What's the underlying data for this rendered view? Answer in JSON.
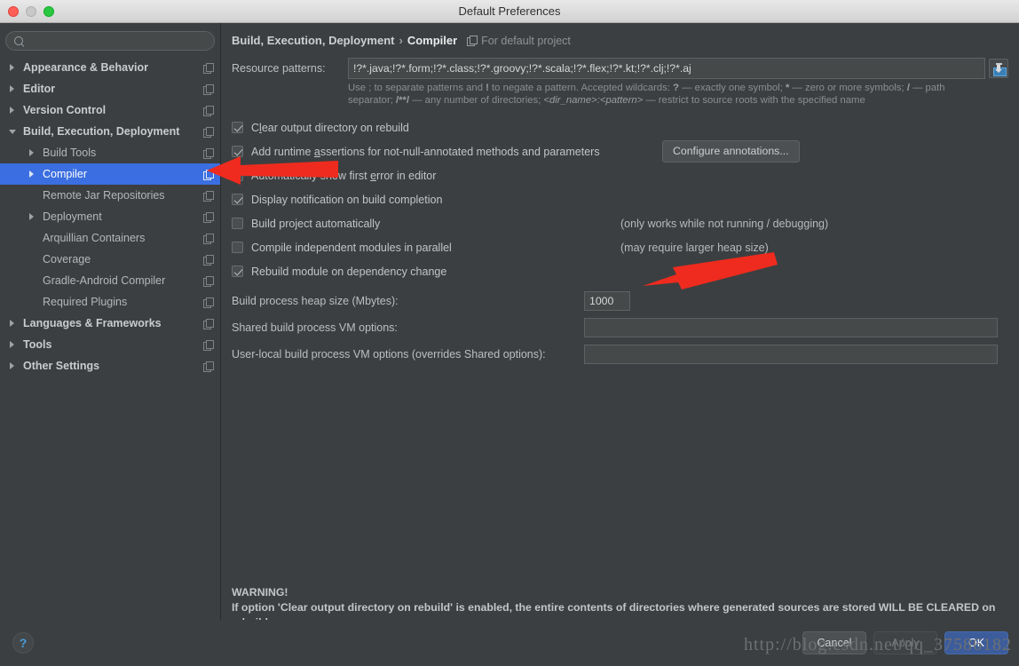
{
  "window": {
    "title": "Default Preferences"
  },
  "search": {
    "value": "",
    "placeholder": ""
  },
  "sidebar": {
    "items": [
      {
        "label": "Appearance & Behavior",
        "level": 0,
        "twisty": "right",
        "selected": false
      },
      {
        "label": "Editor",
        "level": 0,
        "twisty": "right",
        "selected": false
      },
      {
        "label": "Version Control",
        "level": 0,
        "twisty": "right",
        "selected": false
      },
      {
        "label": "Build, Execution, Deployment",
        "level": 0,
        "twisty": "down",
        "selected": false
      },
      {
        "label": "Build Tools",
        "level": 1,
        "twisty": "right",
        "selected": false
      },
      {
        "label": "Compiler",
        "level": 1,
        "twisty": "right",
        "selected": true
      },
      {
        "label": "Remote Jar Repositories",
        "level": 1,
        "twisty": "none",
        "selected": false
      },
      {
        "label": "Deployment",
        "level": 1,
        "twisty": "right",
        "selected": false
      },
      {
        "label": "Arquillian Containers",
        "level": 1,
        "twisty": "none",
        "selected": false
      },
      {
        "label": "Coverage",
        "level": 1,
        "twisty": "none",
        "selected": false
      },
      {
        "label": "Gradle-Android Compiler",
        "level": 1,
        "twisty": "none",
        "selected": false
      },
      {
        "label": "Required Plugins",
        "level": 1,
        "twisty": "none",
        "selected": false
      },
      {
        "label": "Languages & Frameworks",
        "level": 0,
        "twisty": "right",
        "selected": false
      },
      {
        "label": "Tools",
        "level": 0,
        "twisty": "right",
        "selected": false
      },
      {
        "label": "Other Settings",
        "level": 0,
        "twisty": "right",
        "selected": false
      }
    ]
  },
  "breadcrumb": {
    "parent": "Build, Execution, Deployment",
    "separator": "›",
    "current": "Compiler",
    "note": "For default project"
  },
  "main": {
    "pattern_label": "Resource patterns:",
    "pattern_value": "!?*.java;!?*.form;!?*.class;!?*.groovy;!?*.scala;!?*.flex;!?*.kt;!?*.clj;!?*.aj",
    "pattern_hint_line1_a": "Use ; to separate patterns and ",
    "pattern_hint_line1_b": "!",
    "pattern_hint_line1_c": " to negate a pattern. Accepted wildcards: ",
    "pattern_hint_line1_d": "?",
    "pattern_hint_line1_e": " — exactly one symbol; ",
    "pattern_hint_line1_f": "*",
    "pattern_hint_line1_g": " — zero or more symbols; ",
    "pattern_hint_line1_h": "/",
    "pattern_hint_line1_i": " — path separator; ",
    "pattern_hint_line1_j": "/**/",
    "pattern_hint_line1_k": " — any number of directories; ",
    "pattern_hint_line1_l": "<dir_name>:<pattern>",
    "pattern_hint_line1_m": " — restrict to source roots with the specified name",
    "checkboxes": [
      {
        "label_pre": "C",
        "label_mn": "l",
        "label_post": "ear output directory on rebuild",
        "checked": true,
        "note": "",
        "name": "clear-output-directory-on-rebuild"
      },
      {
        "label_pre": "Add runtime ",
        "label_mn": "a",
        "label_post": "ssertions for not-null-annotated methods and parameters",
        "checked": true,
        "note": "",
        "name": "add-runtime-assertions"
      },
      {
        "label_pre": "Automatically show first ",
        "label_mn": "e",
        "label_post": "rror in editor",
        "checked": true,
        "note": "",
        "name": "automatically-show-first-error"
      },
      {
        "label_pre": "Display notification on build completion",
        "label_mn": "",
        "label_post": "",
        "checked": true,
        "note": "",
        "name": "display-notification-on-build-completion"
      },
      {
        "label_pre": "Build project automatically",
        "label_mn": "",
        "label_post": "",
        "checked": false,
        "note": "(only works while not running / debugging)",
        "name": "build-project-automatically"
      },
      {
        "label_pre": "Compile independent modules in parallel",
        "label_mn": "",
        "label_post": "",
        "checked": false,
        "note": "(may require larger heap size)",
        "name": "compile-independent-modules-in-parallel"
      },
      {
        "label_pre": "Rebuild module on dependency change",
        "label_mn": "",
        "label_post": "",
        "checked": true,
        "note": "",
        "name": "rebuild-module-on-dependency-change"
      }
    ],
    "configure_annotations_label": "Configure annotations...",
    "heap_label": "Build process heap size (Mbytes):",
    "heap_value": "1000",
    "shared_vm_label": "Shared build process VM options:",
    "shared_vm_value": "",
    "userlocal_vm_label": "User-local build process VM options (overrides Shared options):",
    "userlocal_vm_value": "",
    "warning_title": "WARNING!",
    "warning_body": "If option 'Clear output directory on rebuild' is enabled, the entire contents of directories where generated sources are stored WILL BE CLEARED on rebuild."
  },
  "footer": {
    "help_label": "?",
    "cancel_label": "Cancel",
    "apply_label": "Apply",
    "ok_label": "OK"
  },
  "watermark": {
    "text": "http://blog.csdn.net/qq_37586182"
  },
  "colors": {
    "background": "#3c3f41",
    "selection": "#3b6ee0",
    "default_button": "#3c5c9b",
    "annotation_arrow": "#ee2b1e",
    "text": "#bbbbbb"
  }
}
